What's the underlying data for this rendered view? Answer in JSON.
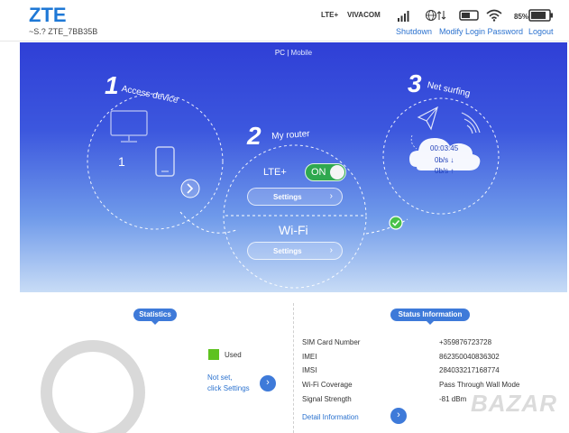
{
  "header": {
    "logo": "ZTE",
    "ssid": "~S.? ZTE_7BB35B",
    "network_type": "LTE+",
    "operator": "VIVACOM",
    "battery_percent": "85%",
    "battery_level": 0.85,
    "links": {
      "shutdown": "Shutdown",
      "modify_login_password": "Modify Login Password",
      "logout": "Logout"
    },
    "icons": [
      "signal-strength-icon",
      "globe-data-icon",
      "sim-card-icon",
      "wifi-icon",
      "battery-icon"
    ]
  },
  "banner": {
    "mode": {
      "pc": "PC",
      "separator": "|",
      "mobile": "Mobile"
    },
    "step1": {
      "number": "1",
      "label": "Access device",
      "device_count": "1"
    },
    "step2": {
      "number": "2",
      "label": "My router",
      "lte_label": "LTE+",
      "toggle_state": "ON",
      "lte_settings": "Settings",
      "wifi_title": "Wi-Fi",
      "wifi_settings": "Settings"
    },
    "step3": {
      "number": "3",
      "label": "Net surfing",
      "time": "00:03:45",
      "down": "0b/s ↓",
      "up": "0b/s ↑"
    }
  },
  "statistics": {
    "badge": "Statistics",
    "used_label": "Used",
    "not_set_line1": "Not set,",
    "not_set_line2": "click Settings",
    "used_color": "#5ec21f",
    "donut_color": "#d9d9d9"
  },
  "status_info": {
    "badge": "Status Information",
    "rows": [
      {
        "key": "SIM Card Number",
        "value": "+359876723728"
      },
      {
        "key": "IMEI",
        "value": "862350040836302"
      },
      {
        "key": "IMSI",
        "value": "284033217168774"
      },
      {
        "key": "Wi-Fi Coverage",
        "value": "Pass Through Wall Mode"
      },
      {
        "key": "Signal Strength",
        "value": "-81 dBm"
      }
    ],
    "detail_link": "Detail Information"
  },
  "watermark": "BAZAR",
  "colors": {
    "accent": "#1e78d6",
    "link": "#2b72cf",
    "badge": "#3e7ad9",
    "toggle_on": "#2fa84f"
  }
}
